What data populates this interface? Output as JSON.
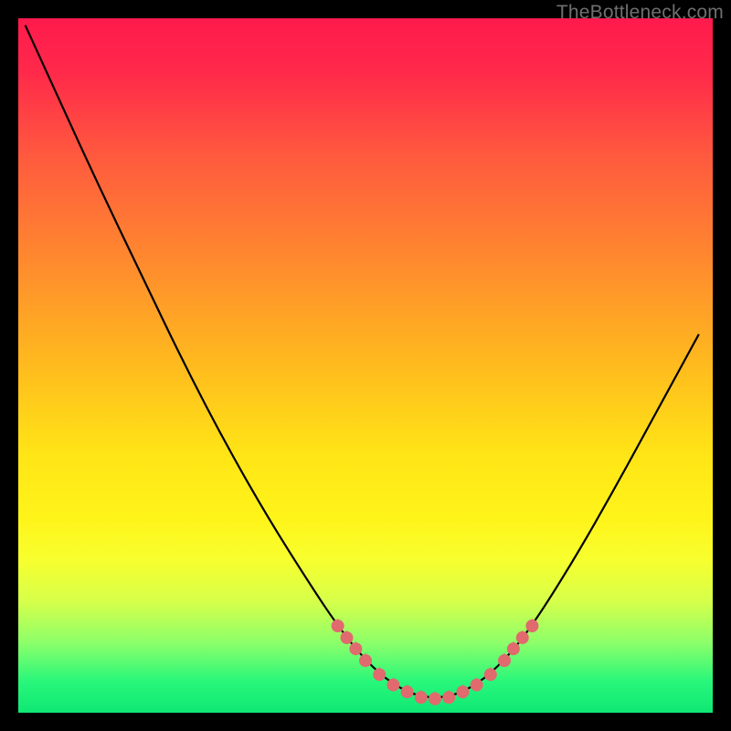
{
  "watermark": "TheBottleneck.com",
  "chart_data": {
    "type": "line",
    "title": "",
    "xlabel": "",
    "ylabel": "",
    "xlim": [
      0,
      100
    ],
    "ylim": [
      0,
      100
    ],
    "background_gradient": {
      "stops": [
        {
          "offset": 0.0,
          "color": "#ff1a4d"
        },
        {
          "offset": 0.08,
          "color": "#ff2a4a"
        },
        {
          "offset": 0.2,
          "color": "#ff5a3e"
        },
        {
          "offset": 0.35,
          "color": "#ff8a2e"
        },
        {
          "offset": 0.5,
          "color": "#ffbb1e"
        },
        {
          "offset": 0.63,
          "color": "#ffe516"
        },
        {
          "offset": 0.72,
          "color": "#fff41a"
        },
        {
          "offset": 0.78,
          "color": "#f7ff2e"
        },
        {
          "offset": 0.84,
          "color": "#d6ff4a"
        },
        {
          "offset": 0.9,
          "color": "#8bff6a"
        },
        {
          "offset": 0.955,
          "color": "#28f77a"
        },
        {
          "offset": 1.0,
          "color": "#0fe874"
        }
      ]
    },
    "curve": [
      {
        "x": 1.0,
        "y": 99.0
      },
      {
        "x": 6.0,
        "y": 88.0
      },
      {
        "x": 12.0,
        "y": 75.0
      },
      {
        "x": 18.0,
        "y": 62.5
      },
      {
        "x": 24.0,
        "y": 50.0
      },
      {
        "x": 30.0,
        "y": 38.5
      },
      {
        "x": 36.0,
        "y": 28.0
      },
      {
        "x": 42.0,
        "y": 18.5
      },
      {
        "x": 46.0,
        "y": 12.5
      },
      {
        "x": 50.0,
        "y": 7.5
      },
      {
        "x": 54.0,
        "y": 4.0
      },
      {
        "x": 58.0,
        "y": 2.2
      },
      {
        "x": 62.0,
        "y": 2.2
      },
      {
        "x": 66.0,
        "y": 4.0
      },
      {
        "x": 70.0,
        "y": 7.5
      },
      {
        "x": 74.0,
        "y": 12.5
      },
      {
        "x": 80.0,
        "y": 22.0
      },
      {
        "x": 86.0,
        "y": 32.5
      },
      {
        "x": 92.0,
        "y": 43.5
      },
      {
        "x": 98.0,
        "y": 54.5
      }
    ],
    "highlight": {
      "band_y": [
        0,
        20
      ],
      "marker_color": "#e06a6e",
      "marker_radius": 7,
      "points": [
        {
          "x": 46.0,
          "y": 12.5
        },
        {
          "x": 47.3,
          "y": 10.8
        },
        {
          "x": 48.6,
          "y": 9.2
        },
        {
          "x": 50.0,
          "y": 7.5
        },
        {
          "x": 52.0,
          "y": 5.5
        },
        {
          "x": 54.0,
          "y": 4.0
        },
        {
          "x": 56.0,
          "y": 3.0
        },
        {
          "x": 58.0,
          "y": 2.2
        },
        {
          "x": 60.0,
          "y": 2.0
        },
        {
          "x": 62.0,
          "y": 2.2
        },
        {
          "x": 64.0,
          "y": 3.0
        },
        {
          "x": 66.0,
          "y": 4.0
        },
        {
          "x": 68.0,
          "y": 5.5
        },
        {
          "x": 70.0,
          "y": 7.5
        },
        {
          "x": 71.3,
          "y": 9.2
        },
        {
          "x": 72.6,
          "y": 10.8
        },
        {
          "x": 74.0,
          "y": 12.5
        }
      ]
    }
  }
}
